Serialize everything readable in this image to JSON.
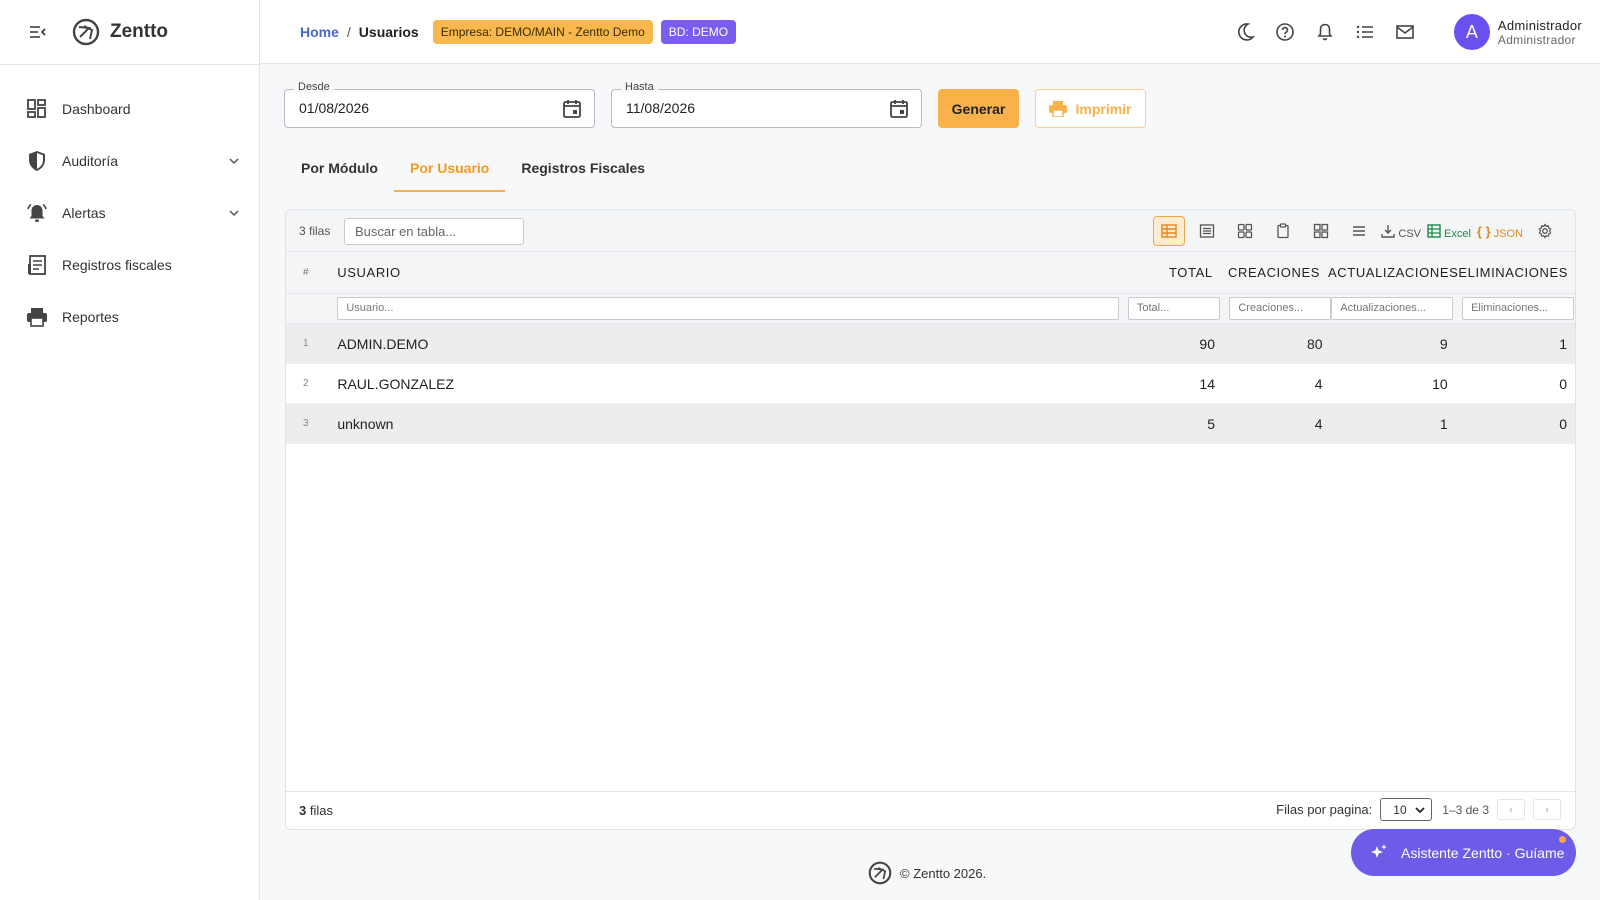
{
  "brand": {
    "name": "Zentto"
  },
  "sidebar": {
    "items": [
      {
        "label": "Dashboard"
      },
      {
        "label": "Auditoría"
      },
      {
        "label": "Alertas"
      },
      {
        "label": "Registros fiscales"
      },
      {
        "label": "Reportes"
      }
    ]
  },
  "header": {
    "breadcrumb_home": "Home",
    "breadcrumb_sep": "/",
    "breadcrumb_current": "Usuarios",
    "badge_empresa": "Empresa: DEMO/MAIN - Zentto Demo",
    "badge_bd": "BD: DEMO",
    "user_initial": "A",
    "user_name": "Administrador",
    "user_role": "Administrador"
  },
  "filters": {
    "desde_label": "Desde",
    "desde_value": "01/08/2026",
    "hasta_label": "Hasta",
    "hasta_value": "11/08/2026",
    "generar_label": "Generar",
    "imprimir_label": "Imprimir"
  },
  "tabs": [
    {
      "label": "Por Módulo",
      "active": false
    },
    {
      "label": "Por Usuario",
      "active": true
    },
    {
      "label": "Registros Fiscales",
      "active": false
    }
  ],
  "grid": {
    "row_count_label": "3 filas",
    "search_placeholder": "Buscar en tabla...",
    "toolbar": {
      "csv": "CSV",
      "excel": "Excel",
      "json": "JSON"
    },
    "columns": {
      "num": "#",
      "usuario": "USUARIO",
      "total": "TOTAL",
      "creaciones": "CREACIONES",
      "actualizaciones": "ACTUALIZACIONES",
      "eliminaciones": "ELIMINACIONES"
    },
    "filter_placeholders": {
      "usuario": "Usuario...",
      "total": "Total...",
      "creaciones": "Creaciones...",
      "actualizaciones": "Actualizaciones...",
      "eliminaciones": "Eliminaciones..."
    },
    "rows": [
      {
        "num": "1",
        "usuario": "ADMIN.DEMO",
        "total": "90",
        "creaciones": "80",
        "actualizaciones": "9",
        "eliminaciones": "1"
      },
      {
        "num": "2",
        "usuario": "RAUL.GONZALEZ",
        "total": "14",
        "creaciones": "4",
        "actualizaciones": "10",
        "eliminaciones": "0"
      },
      {
        "num": "3",
        "usuario": "unknown",
        "total": "5",
        "creaciones": "4",
        "actualizaciones": "1",
        "eliminaciones": "0"
      }
    ],
    "footer": {
      "count_number": "3",
      "count_suffix": "filas",
      "per_page_label": "Filas por pagina:",
      "per_page_value": "10",
      "range": "1–3 de 3",
      "prev": "‹",
      "next": "›"
    }
  },
  "footer": {
    "copyright": "© Zentto 2026."
  },
  "assistant": {
    "label": "Asistente Zentto · Guíame"
  },
  "colors": {
    "accent": "#f9b24a",
    "brand_purple": "#6c5ce7",
    "link_blue": "#4a67c7"
  }
}
